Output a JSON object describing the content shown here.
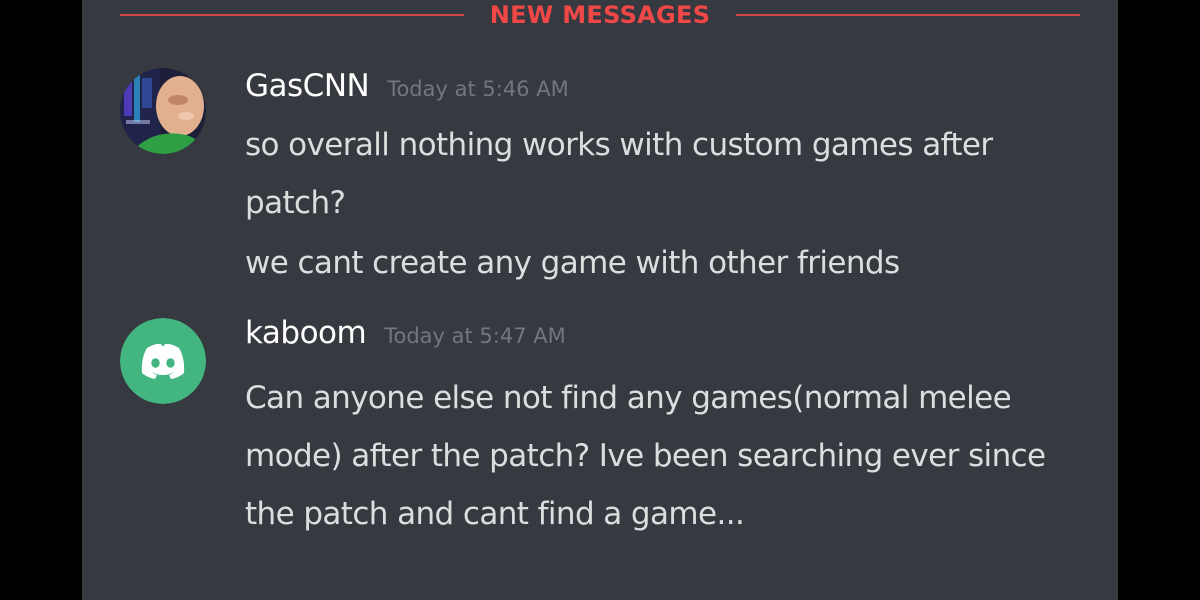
{
  "divider": {
    "label": "NEW MESSAGES"
  },
  "colors": {
    "background": "#36393f",
    "new_messages_red": "#f04747",
    "username": "#ffffff",
    "timestamp": "#72767d",
    "message_text": "#dcddde",
    "discord_avatar_green": "#43b581"
  },
  "messages": [
    {
      "username": "GasCNN",
      "timestamp": "Today at 5:46 AM",
      "avatar_icon": "user-photo-avatar",
      "lines": [
        "so overall nothing works with custom games after patch?",
        "we cant create any game with other friends"
      ]
    },
    {
      "username": "kaboom",
      "timestamp": "Today at 5:47 AM",
      "avatar_icon": "discord-logo-icon",
      "lines": [
        "Can anyone else not find any games(normal melee mode) after the patch? Ive been searching ever since the patch and cant find a game..."
      ]
    }
  ]
}
